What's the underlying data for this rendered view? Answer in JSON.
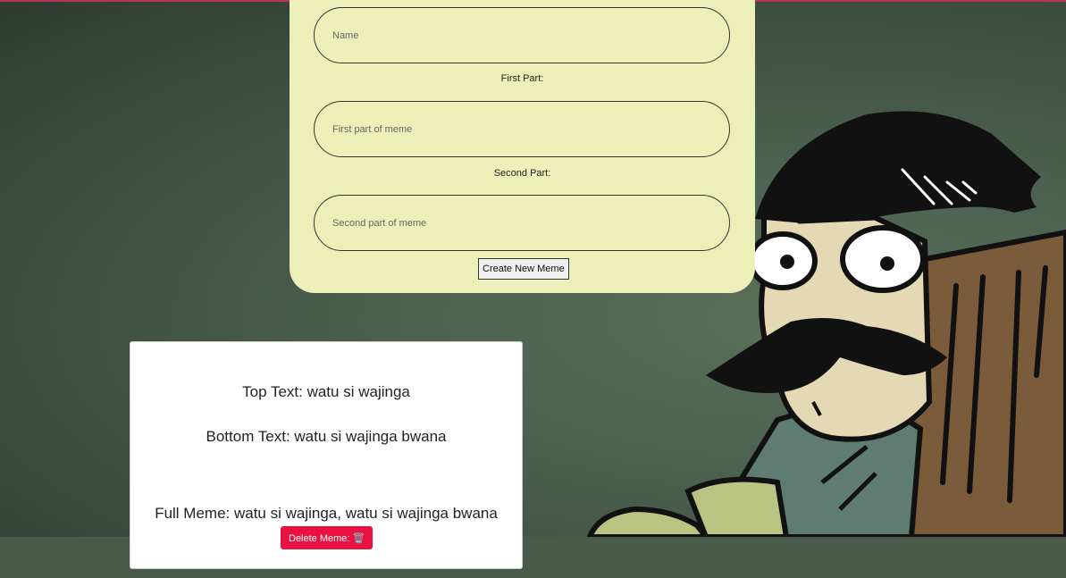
{
  "form": {
    "name_placeholder": "Name",
    "first_part_label": "First Part:",
    "first_part_placeholder": "First part of meme",
    "second_part_label": "Second Part:",
    "second_part_placeholder": "Second part of meme",
    "create_button_label": "Create New Meme"
  },
  "meme": {
    "top_text": "Top Text: watu si wajinga",
    "bottom_text": "Bottom Text: watu si wajinga bwana",
    "full_meme": "Full Meme: watu si wajinga, watu si wajinga bwana",
    "delete_button_label": "Delete Meme: 🗑️"
  },
  "colors": {
    "form_background": "#ecefb7",
    "delete_button": "#e8113f",
    "page_background": "#4c6150"
  },
  "background_image": "cartoon-man-peeking-from-behind-door"
}
